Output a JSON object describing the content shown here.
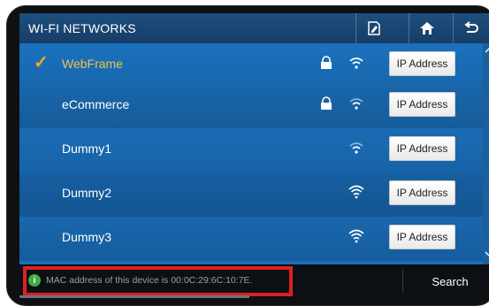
{
  "header": {
    "title": "WI-FI NETWORKS",
    "icons": [
      "edit-icon",
      "home-icon",
      "back-icon"
    ]
  },
  "networks": [
    {
      "name": "WebFrame",
      "selected": true,
      "locked": true,
      "signal": "medium",
      "button": "IP Address"
    },
    {
      "name": "eCommerce",
      "selected": false,
      "locked": true,
      "signal": "medium",
      "button": "IP Address"
    },
    {
      "name": "Dummy1",
      "selected": false,
      "locked": false,
      "signal": "medium",
      "button": "IP Address"
    },
    {
      "name": "Dummy2",
      "selected": false,
      "locked": false,
      "signal": "strong",
      "button": "IP Address"
    },
    {
      "name": "Dummy3",
      "selected": false,
      "locked": false,
      "signal": "strong",
      "button": "IP Address"
    }
  ],
  "footer": {
    "info_text": "MAC address of this device is 00:0C:29:6C:10:7E.",
    "search_label": "Search"
  },
  "colors": {
    "accent": "#f5a623",
    "highlight": "#e02020",
    "row_blue": "#1a6fb8",
    "info_green": "#3fae49"
  }
}
